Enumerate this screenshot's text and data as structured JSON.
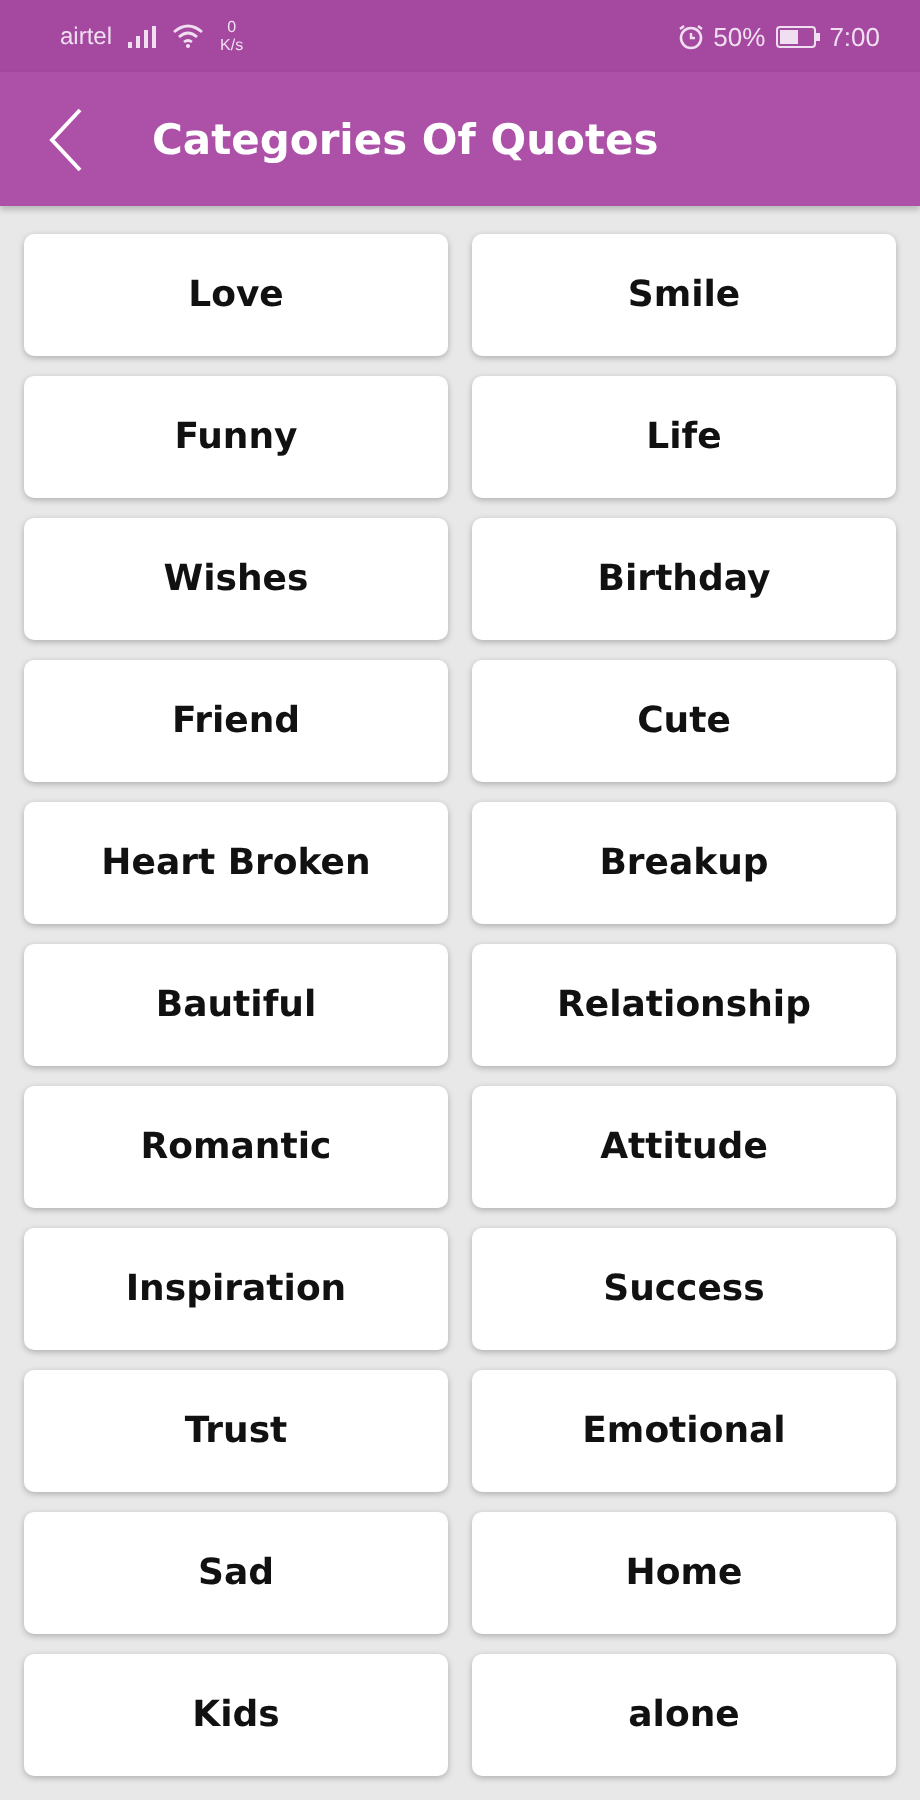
{
  "status_bar": {
    "carrier": "airtel",
    "speed_value": "0",
    "speed_unit": "K/s",
    "battery": "50%",
    "time": "7:00"
  },
  "header": {
    "title": "Categories Of Quotes"
  },
  "categories": [
    "Love",
    "Smile",
    "Funny",
    "Life",
    "Wishes",
    "Birthday",
    "Friend",
    "Cute",
    "Heart Broken",
    "Breakup",
    "Bautiful",
    "Relationship",
    "Romantic",
    "Attitude",
    "Inspiration",
    "Success",
    "Trust",
    "Emotional",
    "Sad",
    "Home",
    "Kids",
    "alone"
  ]
}
